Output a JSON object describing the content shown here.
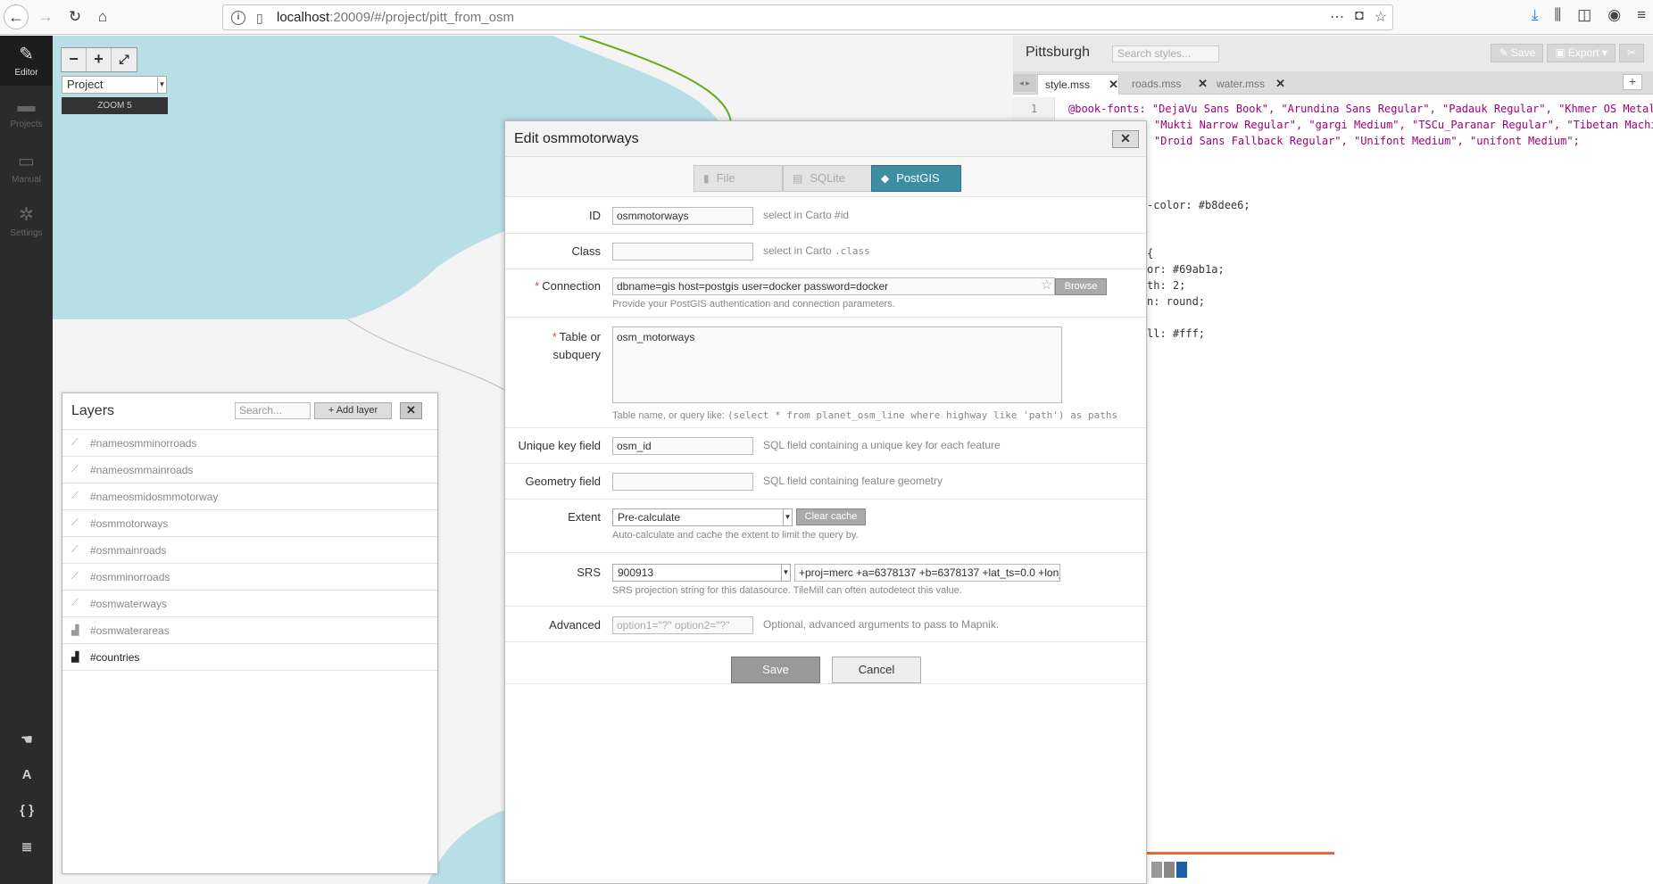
{
  "browser": {
    "url_host": "localhost",
    "url_rest": ":20009/#/project/pitt_from_osm"
  },
  "appbar": {
    "items": [
      {
        "label": "Editor"
      },
      {
        "label": "Projects"
      },
      {
        "label": "Manual"
      },
      {
        "label": "Settings"
      }
    ]
  },
  "map": {
    "project_select": "Project",
    "zoom_label": "ZOOM 5",
    "zoom_minus": "−",
    "zoom_plus": "+",
    "fullscreen": "⤢"
  },
  "layers": {
    "title": "Layers",
    "search_placeholder": "Search...",
    "add_label": "Add layer",
    "close": "✕",
    "items": [
      {
        "name": "#nameosmminorroads"
      },
      {
        "name": "#nameosmmainroads"
      },
      {
        "name": "#nameosmidosmmotorway"
      },
      {
        "name": "#osmmotorways"
      },
      {
        "name": "#osmmainroads"
      },
      {
        "name": "#osmminorroads"
      },
      {
        "name": "#osmwaterways"
      },
      {
        "name": "#osmwaterareas"
      },
      {
        "name": "#countries"
      }
    ]
  },
  "editor": {
    "title": "Pittsburgh",
    "search_placeholder": "Search styles...",
    "save": "Save",
    "export": "Export",
    "tabs": [
      {
        "label": "style.mss"
      },
      {
        "label": "roads.mss"
      },
      {
        "label": "water.mss"
      }
    ],
    "line_number": "1",
    "code": [
      "@book-fonts: \"DejaVu Sans Book\", \"Arundina Sans Regular\", \"Padauk Regular\", \"Khmer OS Metal",
      "\"Mukti Narrow Regular\", \"gargi Medium\", \"TSCu_Paranar Regular\", \"Tibetan Machi",
      "\"Droid Sans Fallback Regular\", \"Unifont Medium\", \"unifont Medium\";",
      "-color: #b8dee6;",
      "{",
      "or: #69ab1a;",
      "th: 2;",
      "n: round;",
      "ll: #fff;"
    ]
  },
  "modal": {
    "title": "Edit osmmotorways",
    "close": "✕",
    "tabs": [
      {
        "label": "File"
      },
      {
        "label": "SQLite"
      },
      {
        "label": "PostGIS"
      }
    ],
    "id_label": "ID",
    "id_value": "osmmotorways",
    "id_hint": "select in Carto #id",
    "class_label": "Class",
    "class_hint_prefix": "select in Carto",
    "class_hint_code": ".class",
    "connection_label": "Connection",
    "connection_value": "dbname=gis host=postgis user=docker password=docker",
    "browse": "Browse",
    "connection_hint": "Provide your PostGIS authentication and connection parameters.",
    "table_label_1": "Table or",
    "table_label_2": "subquery",
    "table_value": "osm_motorways",
    "table_hint_prefix": "Table name, or query like:",
    "table_hint_code": "(select * from planet_osm_line where highway like 'path') as paths",
    "unique_label": "Unique key field",
    "unique_value": "osm_id",
    "unique_hint": "SQL field containing a unique key for each feature",
    "geom_label": "Geometry field",
    "geom_hint": "SQL field containing feature geometry",
    "extent_label": "Extent",
    "extent_value": "Pre-calculate",
    "clear_cache": "Clear cache",
    "extent_hint": "Auto-calculate and cache the extent to limit the query by.",
    "srs_label": "SRS",
    "srs_value": "900913",
    "srs_string": "+proj=merc +a=6378137 +b=6378137 +lat_ts=0.0 +lon_",
    "srs_hint": "SRS projection string for this datasource. TileMill can often autodetect this value.",
    "advanced_label": "Advanced",
    "advanced_placeholder": "option1=\"?\" option2=\"?\"",
    "advanced_hint": "Optional, advanced arguments to pass to Mapnik.",
    "save": "Save",
    "cancel": "Cancel"
  }
}
